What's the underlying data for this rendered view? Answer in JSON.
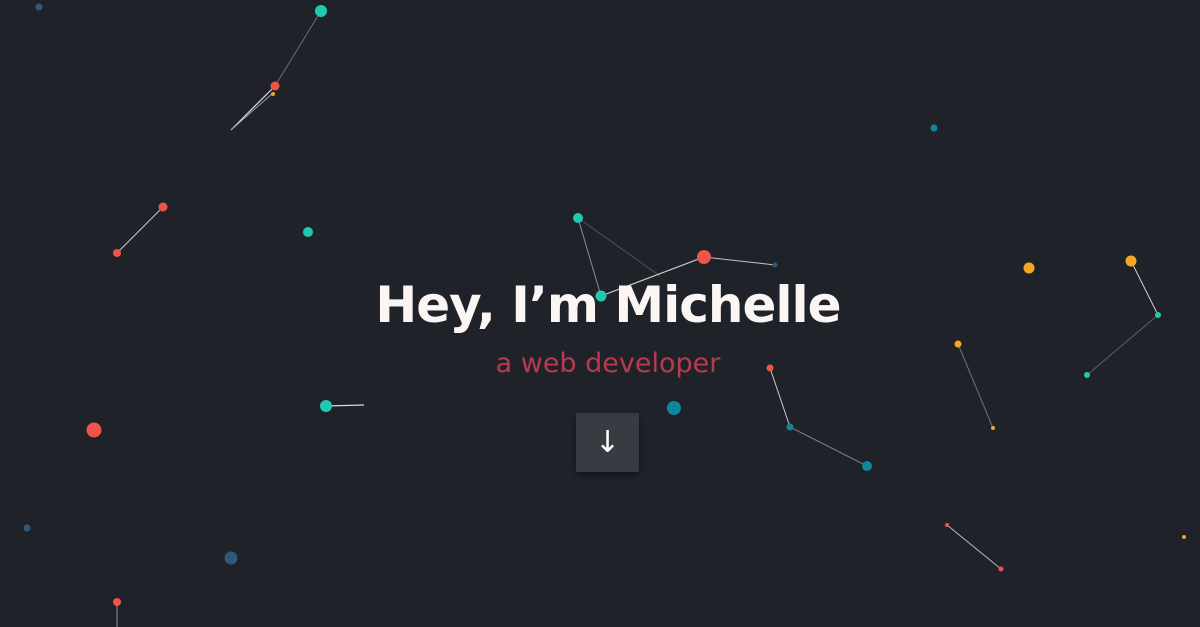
{
  "hero": {
    "headline": "Hey, I’m Michelle",
    "subtitle": "a web developer",
    "scroll_button_label": "↓"
  },
  "colors": {
    "background": "#20222a",
    "headline": "#fbf6f4",
    "subtitle": "#b83a4e",
    "button": "#373c43",
    "particle_red": "#ee5548",
    "particle_teal": "#1fcaae",
    "particle_blue": "#10869e",
    "particle_dark_blue": "#2f5a79",
    "particle_orange": "#f6a623"
  },
  "icons": {
    "scroll_down": "arrow-down-icon"
  }
}
